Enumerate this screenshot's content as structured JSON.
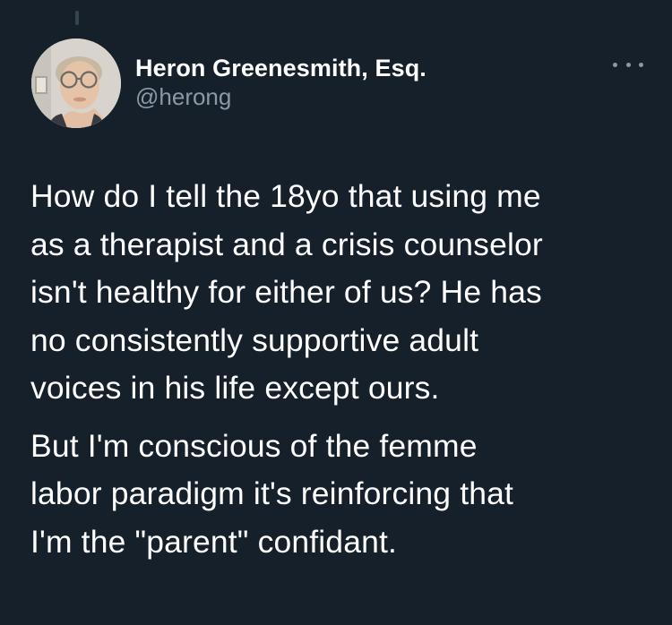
{
  "tweet": {
    "author": {
      "display_name": "Heron Greenesmith, Esq.",
      "handle": "@herong",
      "avatar_icon": "profile-photo"
    },
    "more_icon": "more-options-icon",
    "paragraphs": [
      "How do I tell the 18yo that using me\nas a therapist and a crisis counselor\nisn't healthy for either of us? He has\nno consistently supportive adult\nvoices in his life except ours.",
      "But I'm conscious of the femme\nlabor paradigm it's reinforcing that\nI'm the \"parent\" confidant."
    ]
  },
  "colors": {
    "background": "#15202b",
    "text": "#ffffff",
    "secondary_text": "#8b98a5",
    "thread_line": "#38444d"
  }
}
